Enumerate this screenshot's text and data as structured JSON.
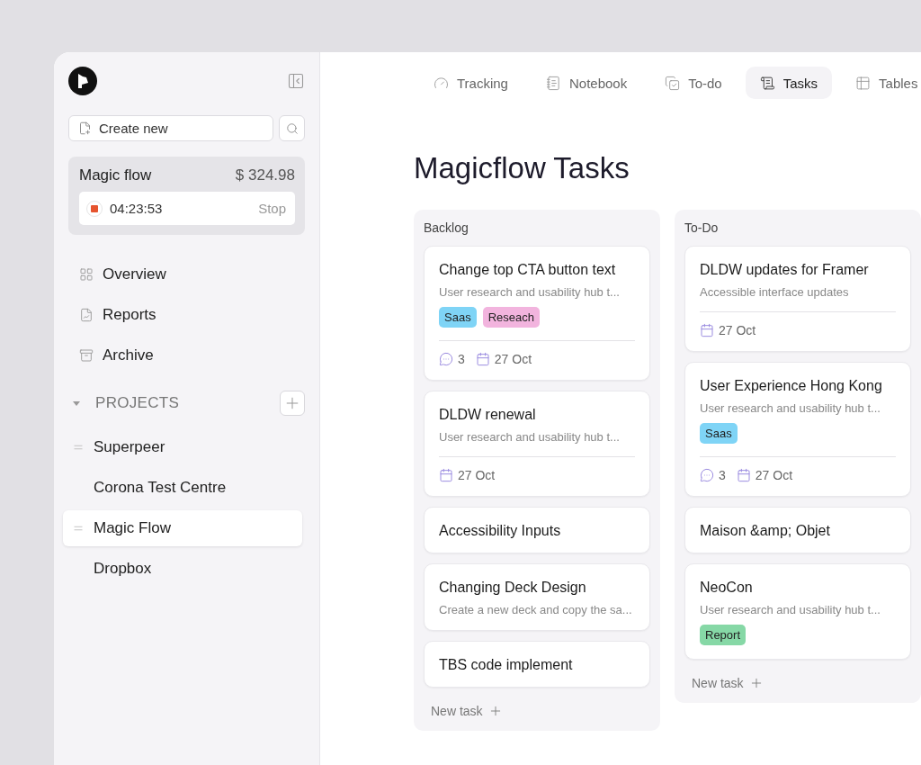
{
  "sidebar": {
    "create_button": "Create new",
    "timer": {
      "project": "Magic flow",
      "amount": "$ 324.98",
      "time": "04:23:53",
      "stop": "Stop",
      "running": true
    },
    "nav": [
      {
        "label": "Overview"
      },
      {
        "label": "Reports"
      },
      {
        "label": "Archive"
      }
    ],
    "projects_heading": "PROJECTS",
    "projects_expanded": true,
    "projects": [
      {
        "label": "Superpeer",
        "selected": false,
        "handle": true
      },
      {
        "label": "Corona Test Centre",
        "selected": false,
        "handle": false
      },
      {
        "label": "Magic Flow",
        "selected": true,
        "handle": true
      },
      {
        "label": "Dropbox",
        "selected": false,
        "handle": false
      }
    ]
  },
  "tabs": [
    {
      "label": "Tracking",
      "selected": false
    },
    {
      "label": "Notebook",
      "selected": false
    },
    {
      "label": "To-do",
      "selected": false
    },
    {
      "label": "Tasks",
      "selected": true
    },
    {
      "label": "Tables",
      "selected": false
    }
  ],
  "title": "Magicflow Tasks",
  "columns": [
    {
      "name": "Backlog",
      "new_task": "New task",
      "cards": [
        {
          "title": "Change top CTA button text",
          "description": "User research and usability hub t...",
          "tags": [
            {
              "label": "Saas",
              "color": "#7fd4f6"
            },
            {
              "label": "Reseach",
              "color": "#f2b4de"
            }
          ],
          "comments": "3",
          "date": "27 Oct"
        },
        {
          "title": "DLDW renewal",
          "description": "User research and usability hub t...",
          "date": "27 Oct"
        },
        {
          "title": "Accessibility Inputs"
        },
        {
          "title": "Changing Deck Design",
          "description": "Create a new deck and copy the sa..."
        },
        {
          "title": "TBS code implement"
        }
      ]
    },
    {
      "name": "To-Do",
      "new_task": "New task",
      "cards": [
        {
          "title": "DLDW updates for Framer",
          "description": "Accessible interface updates",
          "date": "27 Oct"
        },
        {
          "title": "User Experience Hong Kong",
          "description": "User research and usability hub t...",
          "tags": [
            {
              "label": "Saas",
              "color": "#7fd4f6"
            }
          ],
          "comments": "3",
          "date": "27 Oct"
        },
        {
          "title": "Maison &amp; Objet"
        },
        {
          "title": "NeoCon",
          "description": "User research and usability hub t...",
          "tags": [
            {
              "label": "Report",
              "color": "#86d8a6"
            }
          ]
        }
      ]
    }
  ]
}
